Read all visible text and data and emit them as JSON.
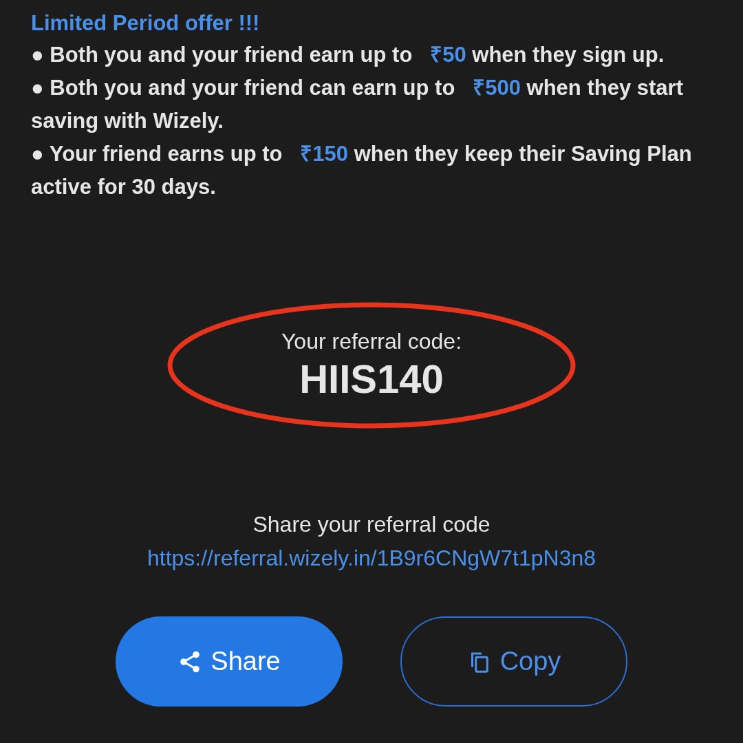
{
  "offer": {
    "title": "Limited Period offer !!!",
    "bullets": [
      {
        "before": "● Both you and your friend earn up to",
        "amount": "₹50",
        "after": "when they sign up."
      },
      {
        "before": "● Both you and your friend can earn up to",
        "amount": "₹500",
        "after": "when they start saving with Wizely."
      },
      {
        "before": "● Your friend earns up to",
        "amount": "₹150",
        "after": "when they keep their Saving Plan active for 30 days."
      }
    ]
  },
  "referral": {
    "label": "Your referral code:",
    "code": "HIIS140",
    "highlighted": true
  },
  "share": {
    "label": "Share your referral code",
    "link": "https://referral.wizely.in/1B9r6CNgW7t1pN3n8"
  },
  "buttons": [
    {
      "kind": "share",
      "label": "Share"
    },
    {
      "kind": "copy",
      "label": "Copy"
    }
  ]
}
